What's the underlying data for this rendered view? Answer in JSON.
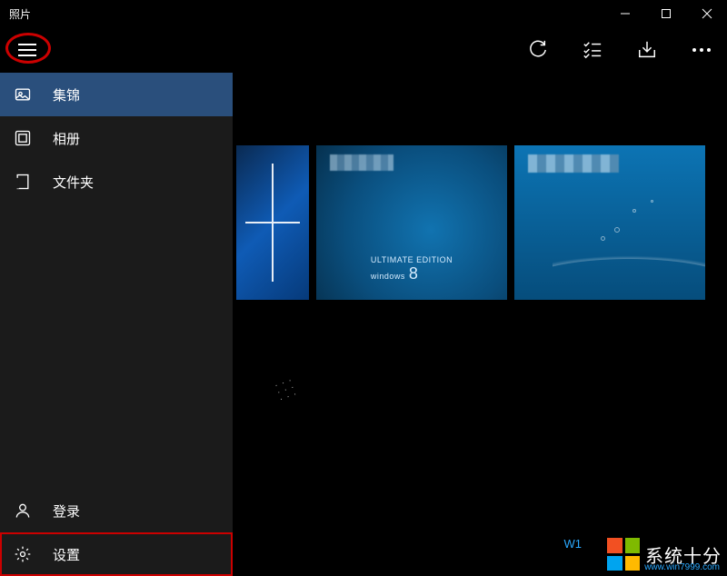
{
  "window": {
    "title": "照片"
  },
  "sidebar": {
    "items": [
      {
        "label": "集锦"
      },
      {
        "label": "相册"
      },
      {
        "label": "文件夹"
      }
    ],
    "login_label": "登录",
    "settings_label": "设置"
  },
  "thumb2": {
    "edition_line1": "ULTIMATE EDITION",
    "edition_line2": "windows",
    "edition_num": "8"
  },
  "content": {
    "link_text": "W1"
  },
  "watermark": {
    "text": "系统十分",
    "url": "www.win7999.com"
  }
}
